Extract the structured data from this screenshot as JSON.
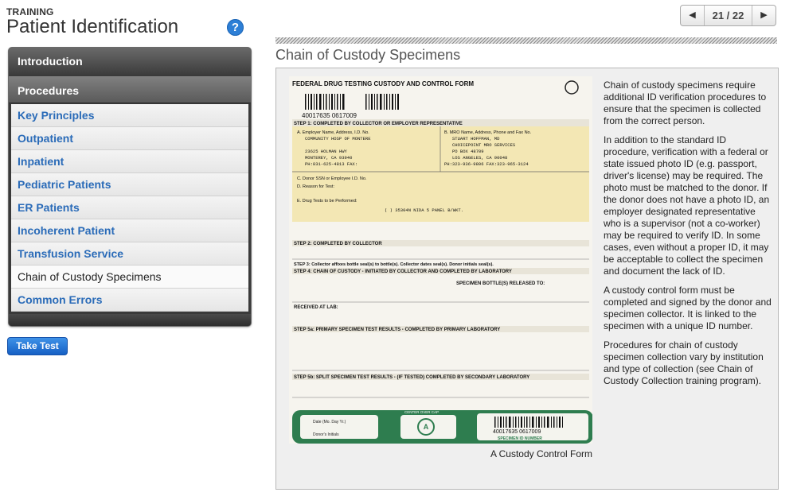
{
  "header": {
    "kicker": "TRAINING",
    "title": "Patient Identification",
    "help_label": "?"
  },
  "pager": {
    "prev_glyph": "◀",
    "next_glyph": "▶",
    "count": "21 / 22"
  },
  "section_title": "Chain of Custody Specimens",
  "nav": {
    "intro": "Introduction",
    "procedures": "Procedures",
    "items": [
      "Key Principles",
      "Outpatient",
      "Inpatient",
      "Pediatric Patients",
      "ER Patients",
      "Incoherent Patient",
      "Transfusion Service",
      "Chain of Custody Specimens",
      "Common Errors"
    ]
  },
  "take_test_label": "Take Test",
  "figure": {
    "caption": "A Custody Control Form",
    "form_title": "FEDERAL DRUG TESTING CUSTODY AND CONTROL FORM",
    "specimen_number": "40017635  0617009",
    "step1": "STEP 1: COMPLETED BY COLLECTOR OR EMPLOYER REPRESENTATIVE",
    "employer_a": "A. Employer Name, Address, I.D. No.",
    "employer_name": "COMMUNITY HOSP OF MONTERE",
    "employer_addr1": "23625 HOLMAN HWY",
    "employer_addr2": "MONTEREY, CA  93940",
    "employer_phone": "PH:831-625-4813 FAX:",
    "mro_b": "B. MRO Name, Address, Phone and Fax No.",
    "mro_name": "STUART HOFFMAN, MD",
    "mro_org": "CHOICEPOINT MRO SERVICES",
    "mro_box": "PO BOX 48709",
    "mro_city": "LOS ANGELES, CA  90048",
    "mro_phone": "PH:323-936-9806 FAX:323-965-3124",
    "donor_c": "C. Donor SSN or Employee I.D. No.",
    "reason_d": "D. Reason for Test:",
    "tests_e": "E. Drug Tests to be Performed:",
    "panel": "( ) 35304N NIDA 5 PANEL B/WKT.",
    "step2": "STEP 2: COMPLETED BY COLLECTOR",
    "step3": "STEP 3: Collector affixes bottle seal(s) to bottle(s). Collector dates seal(s). Donor initials seal(s).",
    "step4": "STEP 4: CHAIN OF CUSTODY - INITIATED BY COLLECTOR AND COMPLETED BY LABORATORY",
    "bottles": "SPECIMEN BOTTLE(S) RELEASED TO:",
    "received": "RECEIVED AT LAB:",
    "step5a": "STEP 5a: PRIMARY SPECIMEN TEST RESULTS - COMPLETED BY PRIMARY LABORATORY",
    "step5b": "STEP 5b: SPLIT SPECIMEN TEST RESULTS - (IF TESTED) COMPLETED BY SECONDARY LABORATORY",
    "seal_label": "SPECIMEN ID NUMBER",
    "seal_center": "A",
    "seal_cap": "CENTER OVER CAP",
    "seal_date": "Date (Mo. Day Yr.)",
    "seal_initials": "Donor's Initials"
  },
  "description": [
    "Chain of custody specimens require additional ID verification procedures to ensure that the specimen is collected from the correct person.",
    "In addition to the standard ID procedure, verification with a federal or state issued photo ID (e.g. passport, driver's license) may be required. The photo must be matched to the donor. If the donor does not have a photo ID, an employer designated representative who is a supervisor (not a co-worker) may be required to verify ID. In some cases, even without a proper ID, it may be acceptable to collect the specimen and document the lack of ID.",
    "A custody control form must be completed and signed by the donor and specimen collector. It is linked to the specimen with a unique ID number.",
    "Procedures for chain of custody specimen collection vary by institution and type of collection (see Chain of Custody Collection training program)."
  ],
  "colors": {
    "accent": "#2a6bb8",
    "form_yellow": "#f3e7b4",
    "seal_green": "#2e7d4f"
  }
}
